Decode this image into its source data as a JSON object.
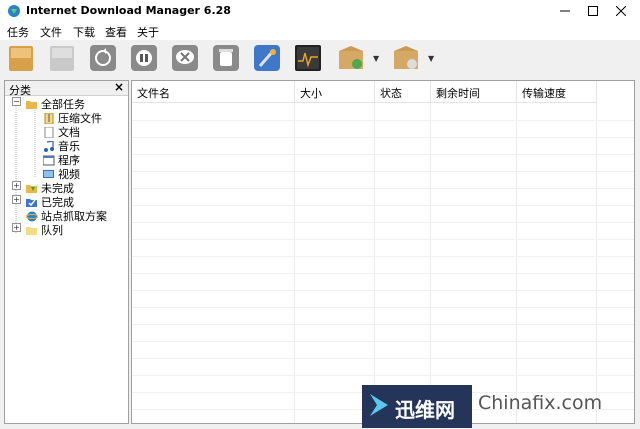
{
  "window": {
    "title": "Internet Download Manager 6.28"
  },
  "menu": [
    "任务",
    "文件",
    "下载",
    "查看",
    "关于"
  ],
  "toolbar": {
    "icons": [
      "add-url-icon",
      "resume-icon",
      "refresh-icon",
      "stop-icon",
      "stop-all-icon",
      "delete-icon",
      "options-icon",
      "scheduler-icon",
      "start-queue-icon",
      "stop-queue-icon"
    ]
  },
  "categories": {
    "title": "分类",
    "close": "×",
    "items": [
      {
        "label": "全部任务",
        "level": 0,
        "expander": "−",
        "icon": "folder-open-icon"
      },
      {
        "label": "压缩文件",
        "level": 1,
        "icon": "archive-icon"
      },
      {
        "label": "文档",
        "level": 1,
        "icon": "document-icon"
      },
      {
        "label": "音乐",
        "level": 1,
        "icon": "music-icon"
      },
      {
        "label": "程序",
        "level": 1,
        "icon": "program-icon"
      },
      {
        "label": "视频",
        "level": 1,
        "icon": "video-icon"
      },
      {
        "label": "未完成",
        "level": 0,
        "expander": "+",
        "icon": "unfinished-folder-icon"
      },
      {
        "label": "已完成",
        "level": 0,
        "expander": "+",
        "icon": "finished-folder-icon"
      },
      {
        "label": "站点抓取方案",
        "level": 0,
        "icon": "site-grabber-icon"
      },
      {
        "label": "队列",
        "level": 0,
        "expander": "+",
        "icon": "queue-folder-icon"
      }
    ]
  },
  "columns": [
    "文件名",
    "大小",
    "状态",
    "剩余时间",
    "传输速度"
  ],
  "watermark": {
    "brand": "迅维网",
    "site": "Chinafix.com"
  },
  "colors": {
    "accent": "#25355a",
    "folder": "#e8b84a"
  }
}
